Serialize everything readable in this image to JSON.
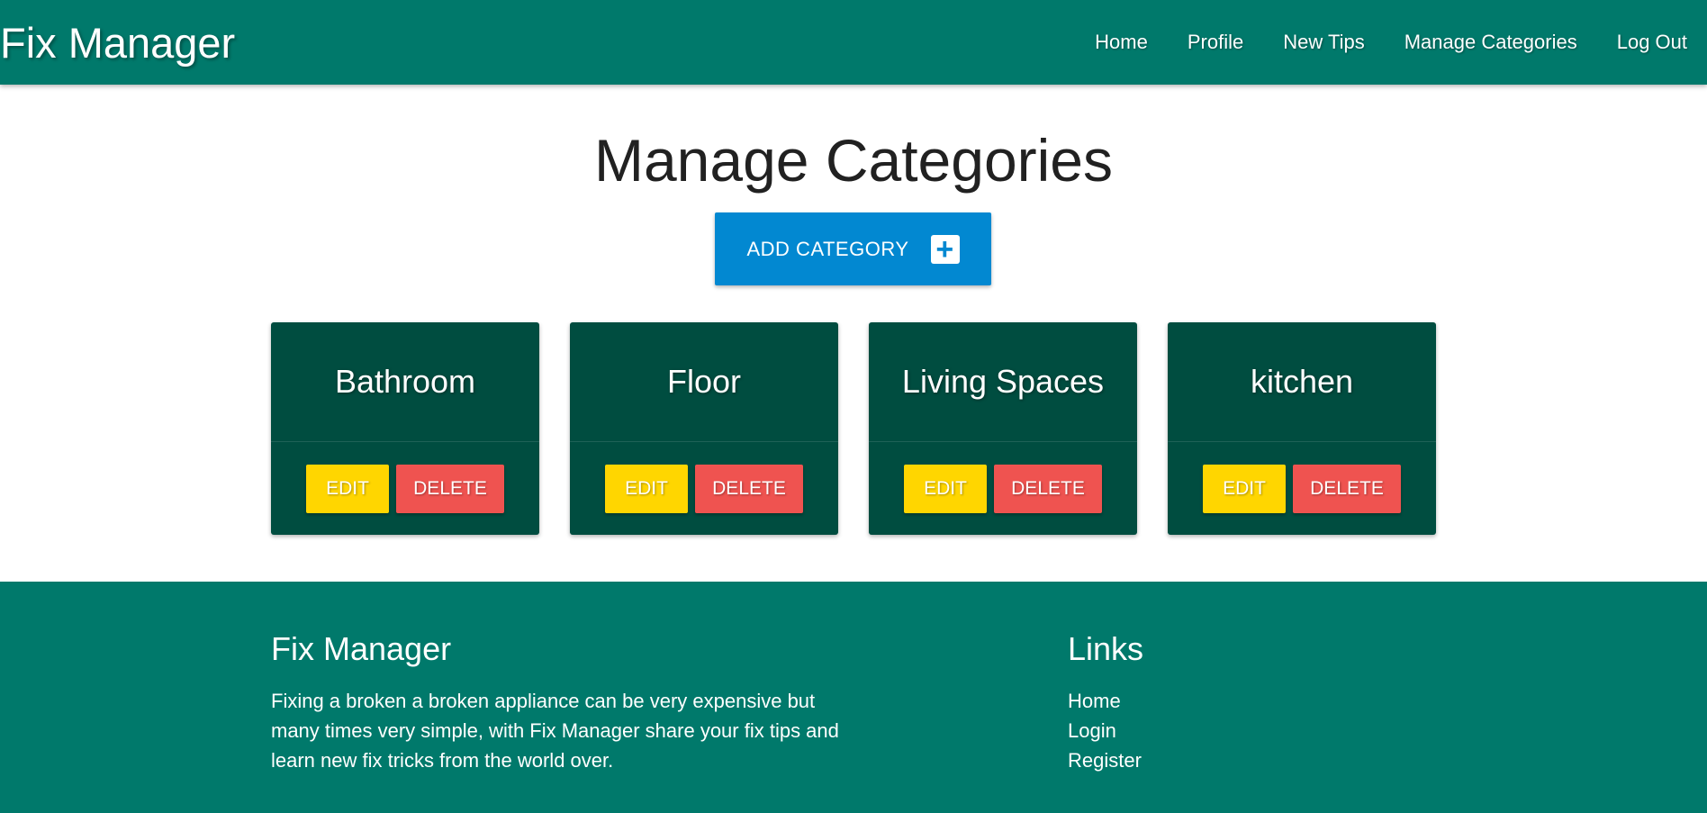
{
  "navbar": {
    "brand": "Fix Manager",
    "links": [
      "Home",
      "Profile",
      "New Tips",
      "Manage Categories",
      "Log Out"
    ]
  },
  "main": {
    "title": "Manage Categories",
    "add_button_label": "ADD CATEGORY",
    "add_icon": "plus-icon",
    "categories": [
      {
        "name": "Bathroom",
        "edit_label": "EDIT",
        "delete_label": "DELETE"
      },
      {
        "name": "Floor",
        "edit_label": "EDIT",
        "delete_label": "DELETE"
      },
      {
        "name": "Living Spaces",
        "edit_label": "EDIT",
        "delete_label": "DELETE"
      },
      {
        "name": "kitchen",
        "edit_label": "EDIT",
        "delete_label": "DELETE"
      }
    ]
  },
  "footer": {
    "title": "Fix Manager",
    "description": "Fixing a broken a broken appliance can be very expensive but many times very simple, with Fix Manager share your fix tips and learn new fix tricks from the world over.",
    "links_title": "Links",
    "links": [
      "Home",
      "Login",
      "Register"
    ]
  },
  "colors": {
    "primary": "#00796b",
    "card": "#004d40",
    "add_button": "#0288d1",
    "edit_button": "#ffd600",
    "delete_button": "#ef5350"
  }
}
